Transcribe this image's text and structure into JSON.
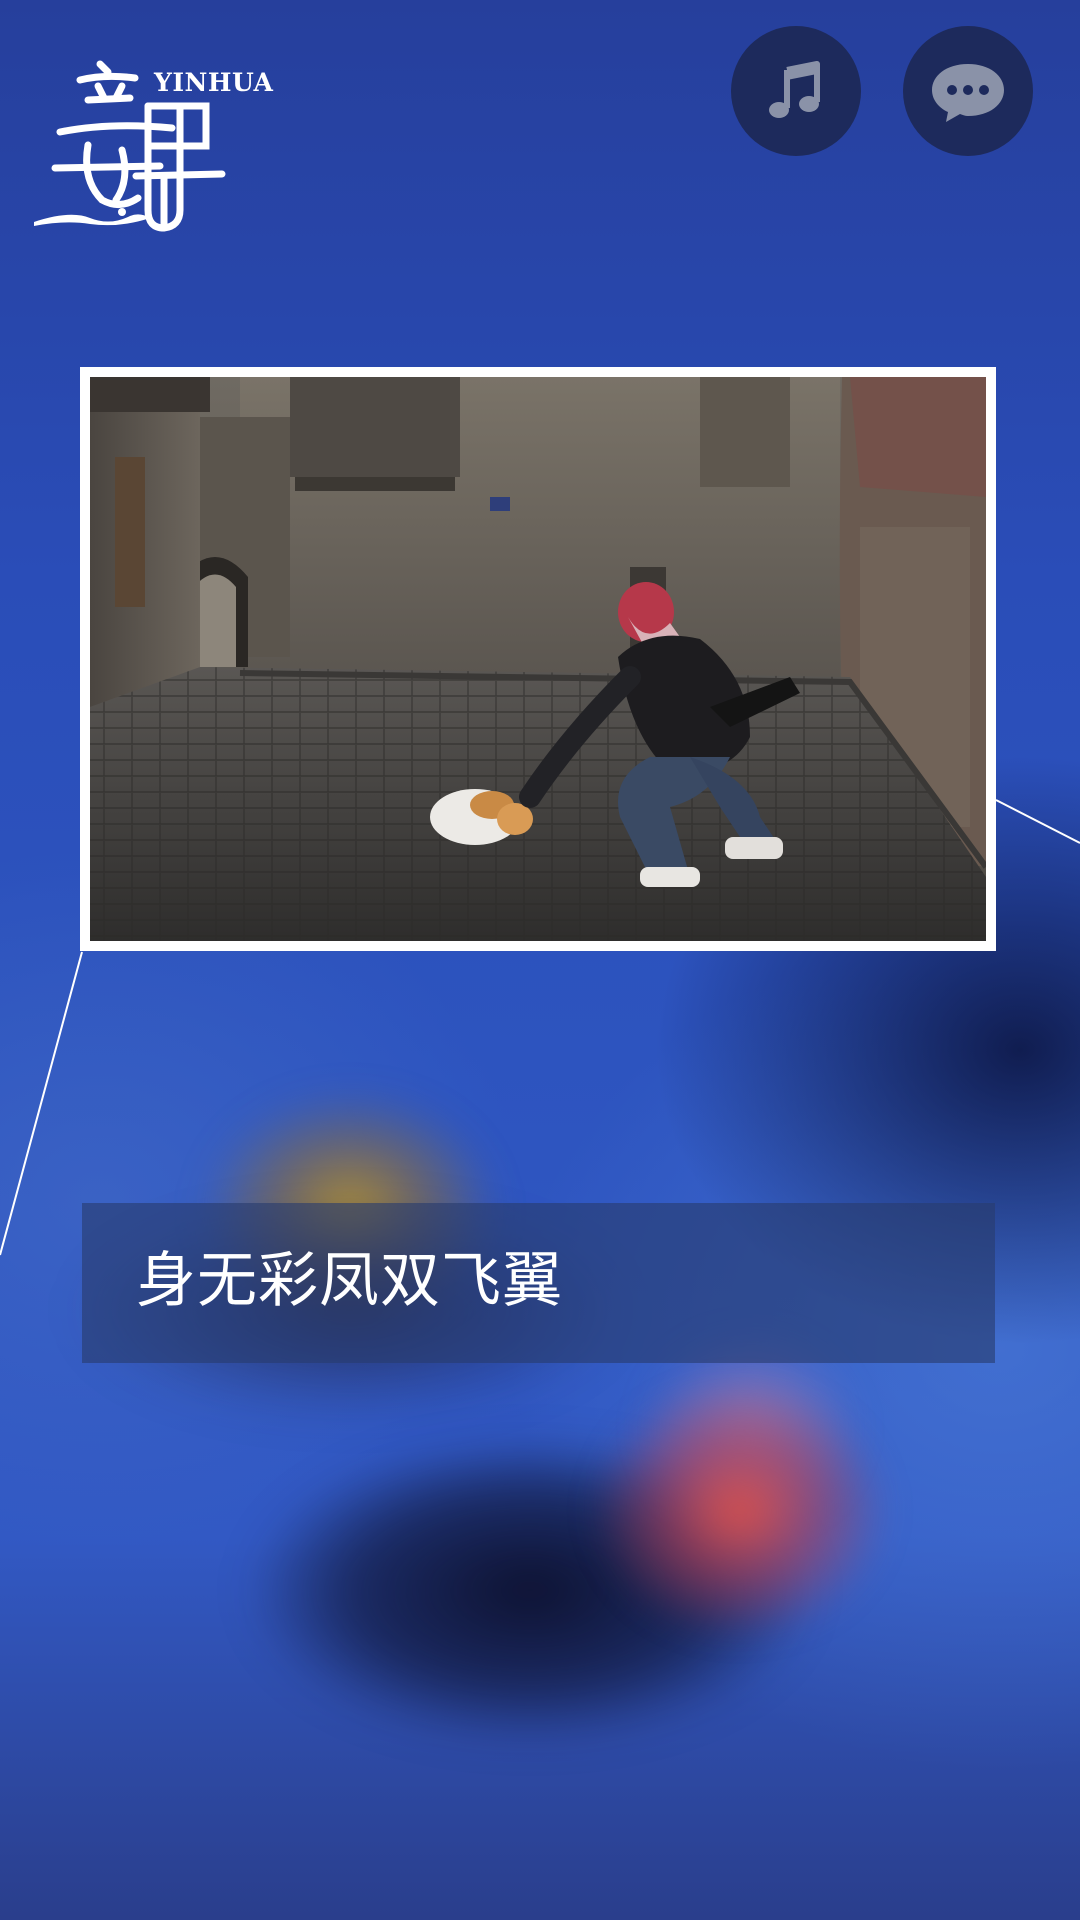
{
  "logo": {
    "latin_text": "YINHUA",
    "icon": "yinhua-calligraphy-logo"
  },
  "header": {
    "music_button_icon": "music-note-icon",
    "chat_button_icon": "chat-bubble-icon"
  },
  "photo": {
    "icon": "street-cat-photo"
  },
  "caption": {
    "text": "身无彩凤双飞翼"
  },
  "colors": {
    "background": "#2a4aa6",
    "button_bg": "#1d2a5c",
    "caption_bg": "#283c6e",
    "frame": "#ffffff"
  }
}
